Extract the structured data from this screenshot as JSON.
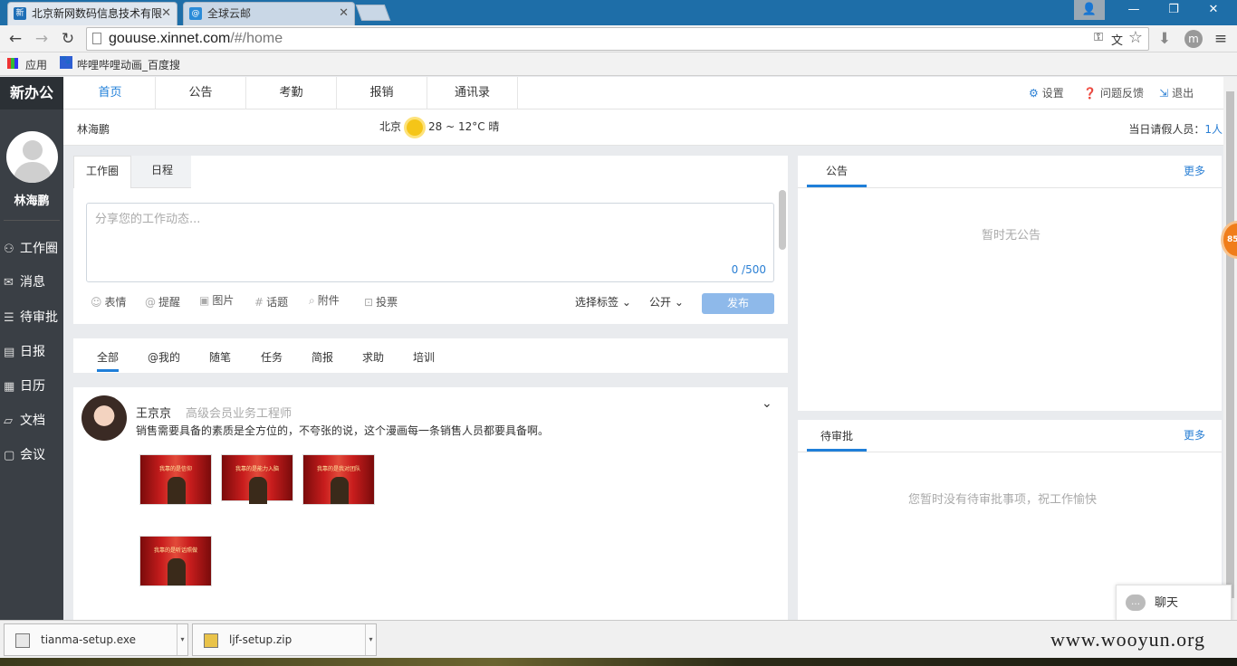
{
  "browser": {
    "tabs": [
      {
        "label": "北京新网数码信息技术有限",
        "favicon": "新"
      },
      {
        "label": "全球云邮",
        "favicon": "@"
      }
    ],
    "url_host": "gouuse.xinnet.com",
    "url_path": "/#/home",
    "bookmarks": [
      {
        "label": "应用"
      },
      {
        "label": "哔哩哔哩动画_百度搜"
      }
    ]
  },
  "app": {
    "logo": "新办公",
    "user_name": "林海鹏",
    "sidebar": [
      {
        "label": "工作圈",
        "icon": "network-icon",
        "glyph": "⚇"
      },
      {
        "label": "消息",
        "icon": "chat-icon",
        "glyph": "✉"
      },
      {
        "label": "待审批",
        "icon": "clipboard-icon",
        "glyph": "☰"
      },
      {
        "label": "日报",
        "icon": "document-icon",
        "glyph": "▤"
      },
      {
        "label": "日历",
        "icon": "calendar-icon",
        "glyph": "▦"
      },
      {
        "label": "文档",
        "icon": "folder-icon",
        "glyph": "▱"
      },
      {
        "label": "会议",
        "icon": "meeting-icon",
        "glyph": "▢"
      }
    ],
    "topnav": [
      "首页",
      "公告",
      "考勤",
      "报销",
      "通讯录"
    ],
    "topnav_right": {
      "settings": "设置",
      "feedback": "问题反馈",
      "logout": "退出"
    },
    "info": {
      "user": "林海鹏",
      "city": "北京",
      "weather": "28 ~ 12°C 晴",
      "leave_label": "当日请假人员：",
      "leave_count": "1人"
    },
    "compose": {
      "tabs": [
        "工作圈",
        "日程"
      ],
      "placeholder": "分享您的工作动态...",
      "counter": "0 /500",
      "tools": [
        "表情",
        "提醒",
        "图片",
        "话题",
        "附件",
        "投票"
      ],
      "tag_select": "选择标签",
      "visibility": "公开",
      "publish": "发布"
    },
    "feed_tabs": [
      "全部",
      "@我的",
      "随笔",
      "任务",
      "简报",
      "求助",
      "培训"
    ],
    "post": {
      "author": "王京京",
      "role": "高级会员业务工程师",
      "text": "销售需要具备的素质是全方位的，不夸张的说，这个漫画每一条销售人员都要具备啊。",
      "images": [
        "我靠的是信仰",
        "我靠的是能力入脑",
        "我靠的是我对团队",
        "我靠的是听话照做"
      ]
    },
    "notice": {
      "title": "公告",
      "more": "更多",
      "empty": "暂时无公告"
    },
    "approval": {
      "title": "待审批",
      "more": "更多",
      "empty": "您暂时没有待审批事项，祝工作愉快"
    },
    "chat": "聊天",
    "badge": "85"
  },
  "taskbar": {
    "downloads": [
      "tianma-setup.exe",
      "ljf-setup.zip"
    ],
    "watermark": "www.wooyun.org"
  }
}
